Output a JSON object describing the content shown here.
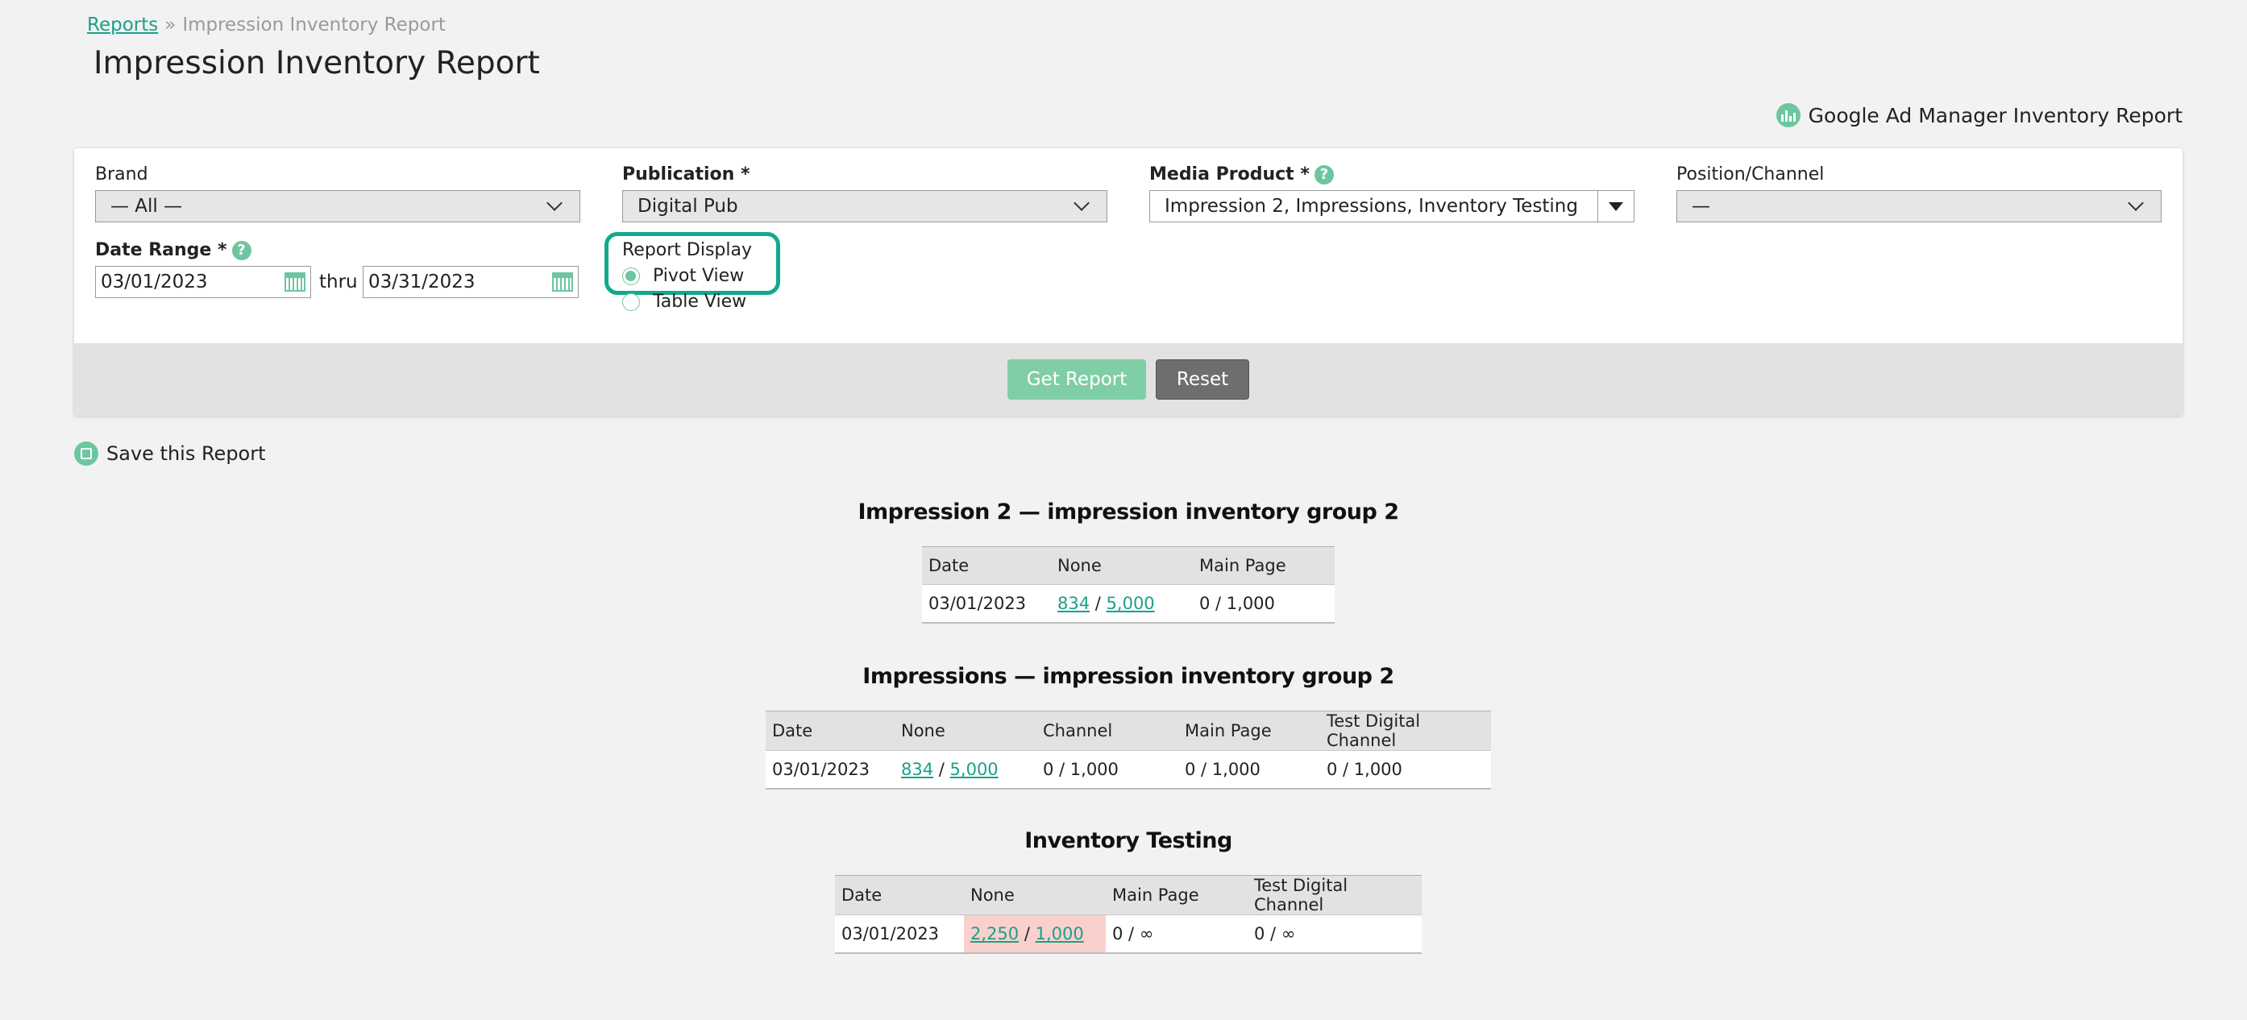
{
  "breadcrumb": {
    "root": "Reports",
    "separator": "»",
    "current": "Impression Inventory Report"
  },
  "page_title": "Impression Inventory Report",
  "gam_link": "Google Ad Manager Inventory Report",
  "filters": {
    "brand": {
      "label": "Brand",
      "value": "— All —"
    },
    "publication": {
      "label": "Publication *",
      "value": "Digital Pub"
    },
    "media_product": {
      "label": "Media Product *",
      "value": "Impression 2, Impressions, Inventory Testing"
    },
    "position": {
      "label": "Position/Channel",
      "value": "—"
    },
    "date_range": {
      "label": "Date Range *",
      "from": "03/01/2023",
      "thru": "thru",
      "to": "03/31/2023"
    },
    "report_display": {
      "label": "Report Display",
      "options": [
        "Pivot View",
        "Table View"
      ],
      "selected": "Pivot View"
    },
    "help_glyph": "?"
  },
  "buttons": {
    "get_report": "Get Report",
    "reset": "Reset"
  },
  "save_report": "Save this Report",
  "icons": {
    "calendar": "calendar-icon",
    "help": "help-icon",
    "chart": "chart-icon",
    "save": "save-icon"
  },
  "colors": {
    "accent": "#14a88c",
    "link": "#1aa08a",
    "green": "#6cc6a0",
    "over_limit": "#f9d0cc"
  },
  "tables": [
    {
      "title": "Impression 2 — impression inventory group 2",
      "columns": [
        "Date",
        "None",
        "Main Page"
      ],
      "row": {
        "date": "03/01/2023",
        "none_used": "834",
        "none_sep": "/",
        "none_total": "5,000",
        "cells": [
          "0 / 1,000"
        ]
      }
    },
    {
      "title": "Impressions — impression inventory group 2",
      "columns": [
        "Date",
        "None",
        "Channel",
        "Main Page",
        "Test Digital Channel"
      ],
      "row": {
        "date": "03/01/2023",
        "none_used": "834",
        "none_sep": "/",
        "none_total": "5,000",
        "cells": [
          "0 / 1,000",
          "0 / 1,000",
          "0 / 1,000"
        ]
      }
    },
    {
      "title": "Inventory Testing",
      "columns": [
        "Date",
        "None",
        "Main Page",
        "Test Digital Channel"
      ],
      "row": {
        "date": "03/01/2023",
        "none_used": "2,250",
        "none_sep": "/",
        "none_total": "1,000",
        "cells": [
          "0 / ∞",
          "0 / ∞"
        ]
      }
    }
  ]
}
